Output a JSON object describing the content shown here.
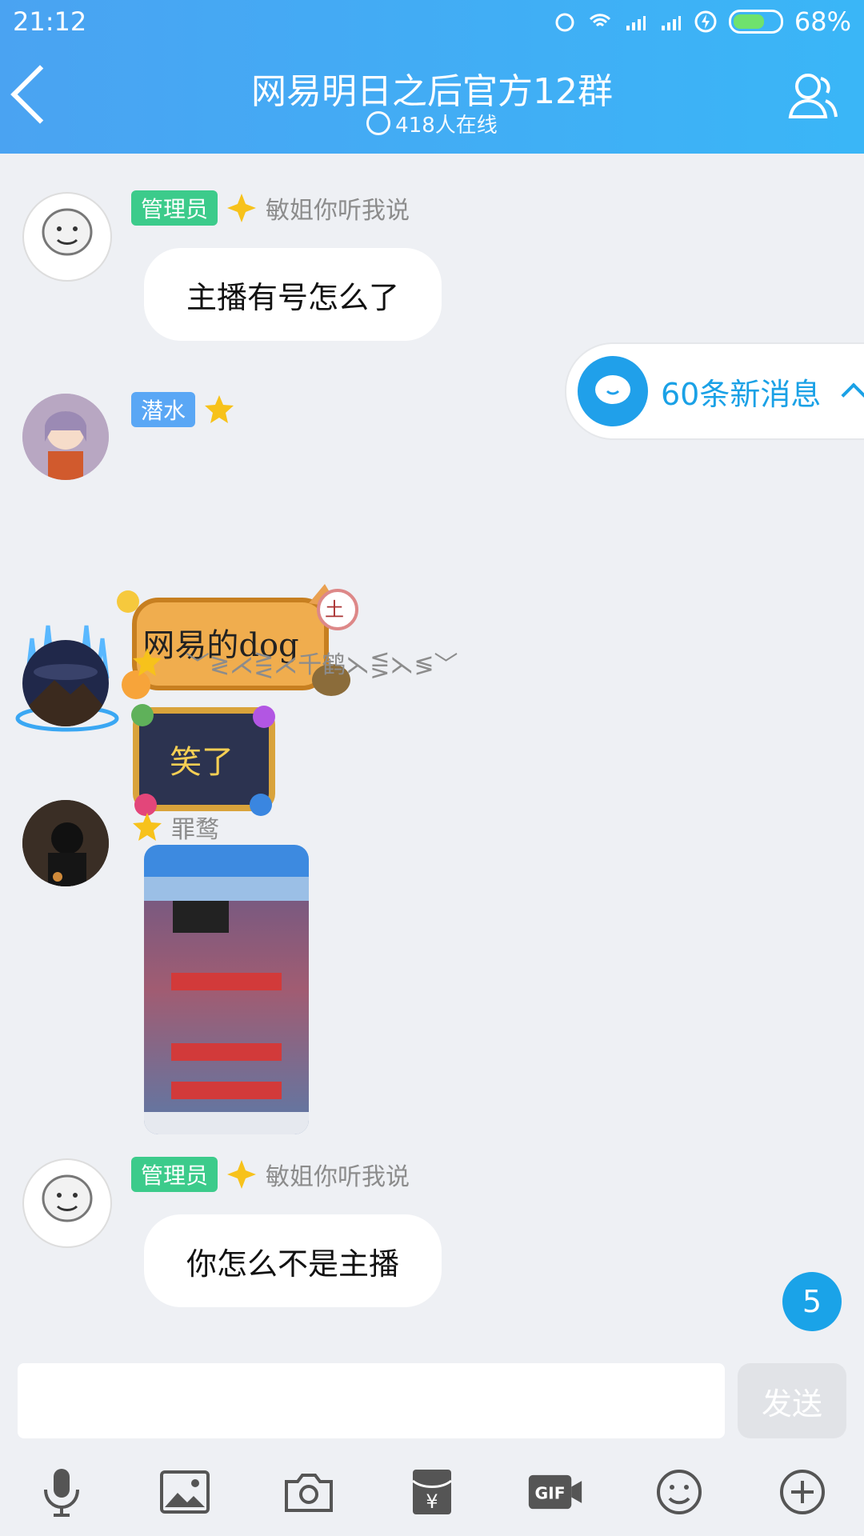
{
  "status_bar": {
    "time": "21:12",
    "battery": "68%"
  },
  "header": {
    "title": "网易明日之后官方12群",
    "online": "418人在线"
  },
  "new_messages": {
    "label": "60条新消息"
  },
  "messages": [
    {
      "role_tag": "管理员",
      "name": "敏姐你听我说",
      "text": "主播有号怎么了"
    },
    {
      "role_tag": "潜水",
      "name": "",
      "sticker_text": "网易的dog"
    },
    {
      "role_tag": "",
      "name": "﹀≷⋌⋛⋌千鹤⋋⋚⋋≶﹀",
      "sticker_text": "笑了"
    },
    {
      "role_tag": "",
      "name": "罪鹜",
      "type": "image"
    },
    {
      "role_tag": "管理员",
      "name": "敏姐你听我说",
      "text": "你怎么不是主播"
    }
  ],
  "unread_badge": "5",
  "input": {
    "placeholder": "",
    "send_label": "发送"
  },
  "toolbar": [
    "mic-icon",
    "image-icon",
    "camera-icon",
    "red-packet-icon",
    "gif-icon",
    "emoji-icon",
    "plus-icon"
  ]
}
